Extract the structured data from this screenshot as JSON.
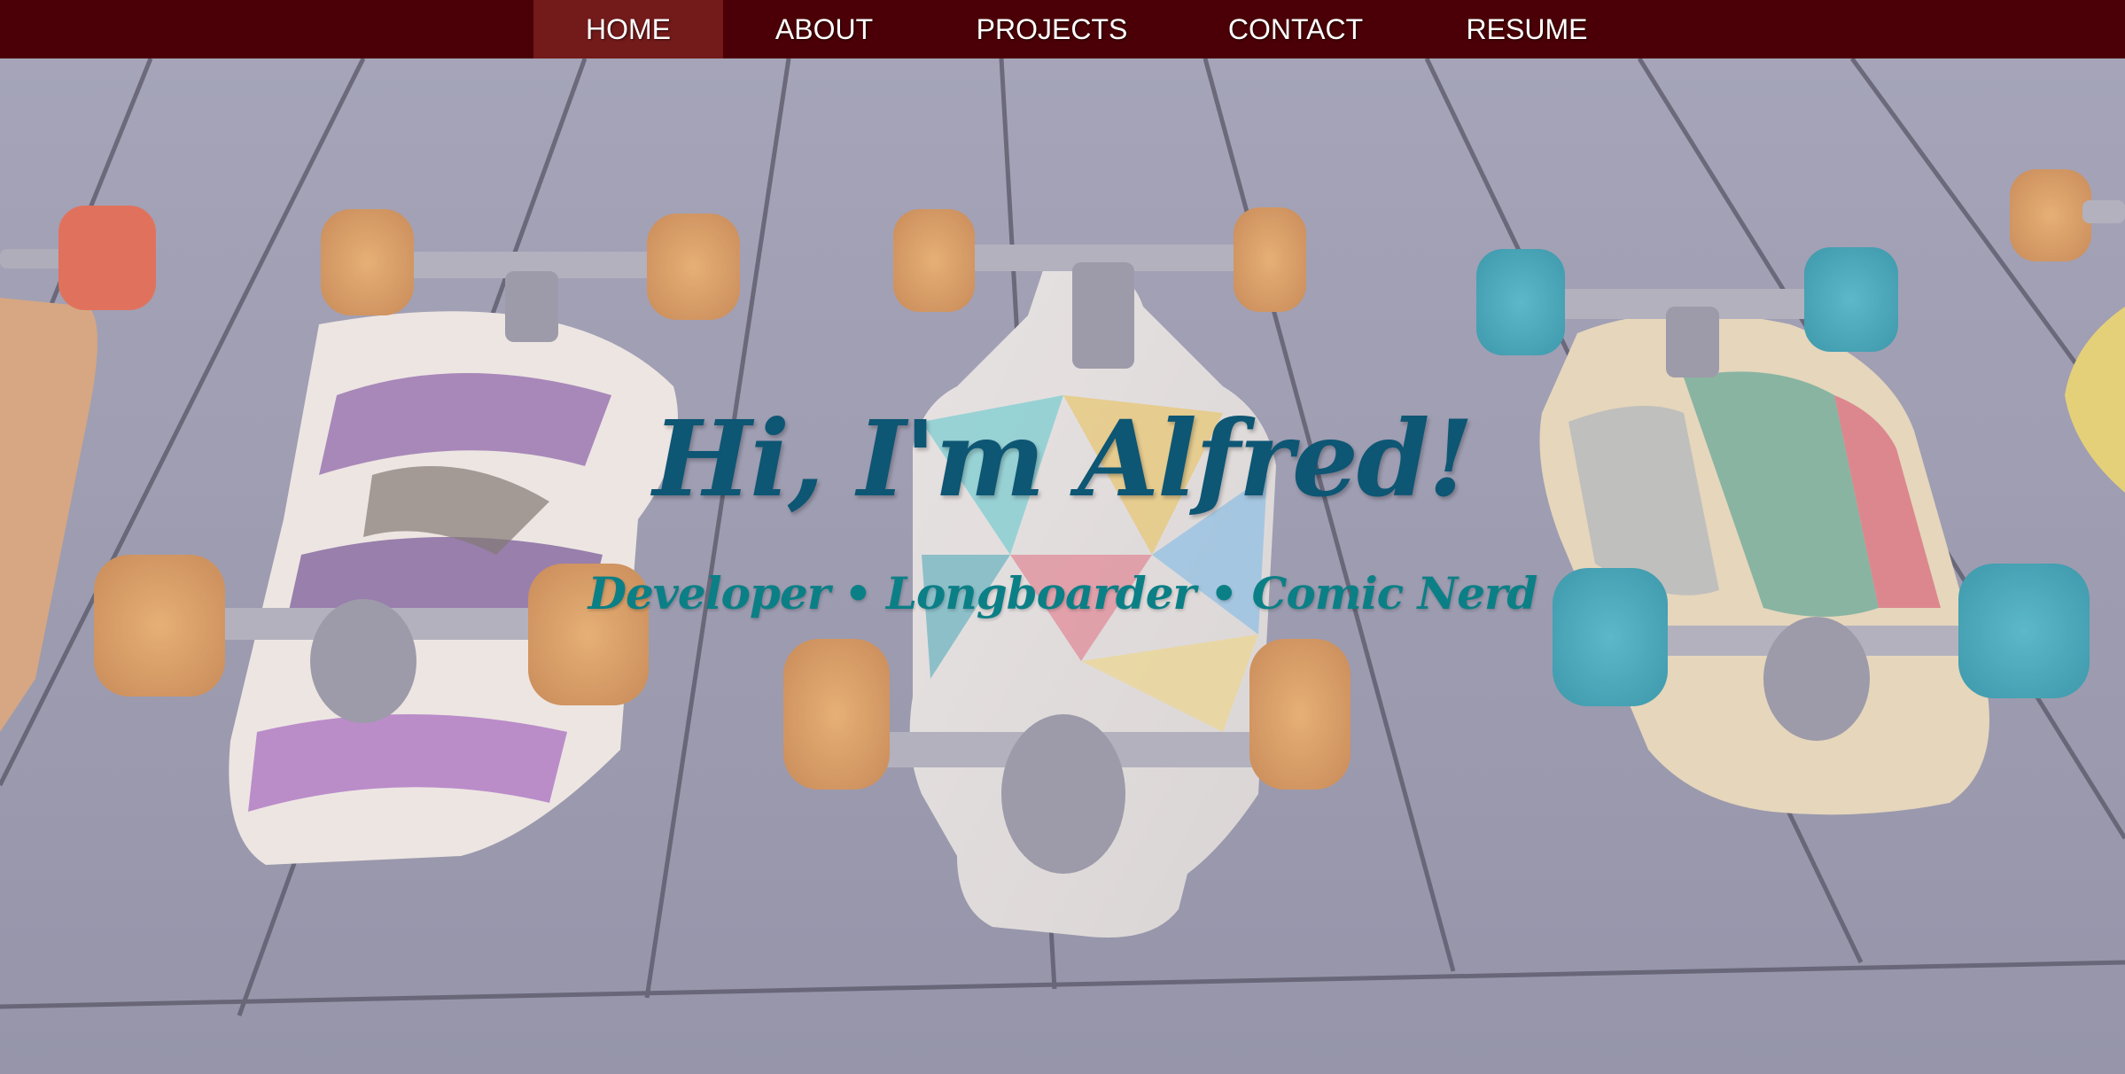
{
  "nav": {
    "items": [
      {
        "label": "HOME",
        "active": true
      },
      {
        "label": "ABOUT",
        "active": false
      },
      {
        "label": "PROJECTS",
        "active": false
      },
      {
        "label": "CONTACT",
        "active": false
      },
      {
        "label": "RESUME",
        "active": false
      }
    ]
  },
  "hero": {
    "title": "Hi, I'm Alfred!",
    "tagline": "Developer • Longboarder • Comic Nerd",
    "background_image": "longboards-on-wooden-deck"
  },
  "colors": {
    "nav_background": "#4a0006",
    "nav_active": "#731a1a",
    "title": "#0d5674",
    "tagline": "#0b7f86"
  }
}
